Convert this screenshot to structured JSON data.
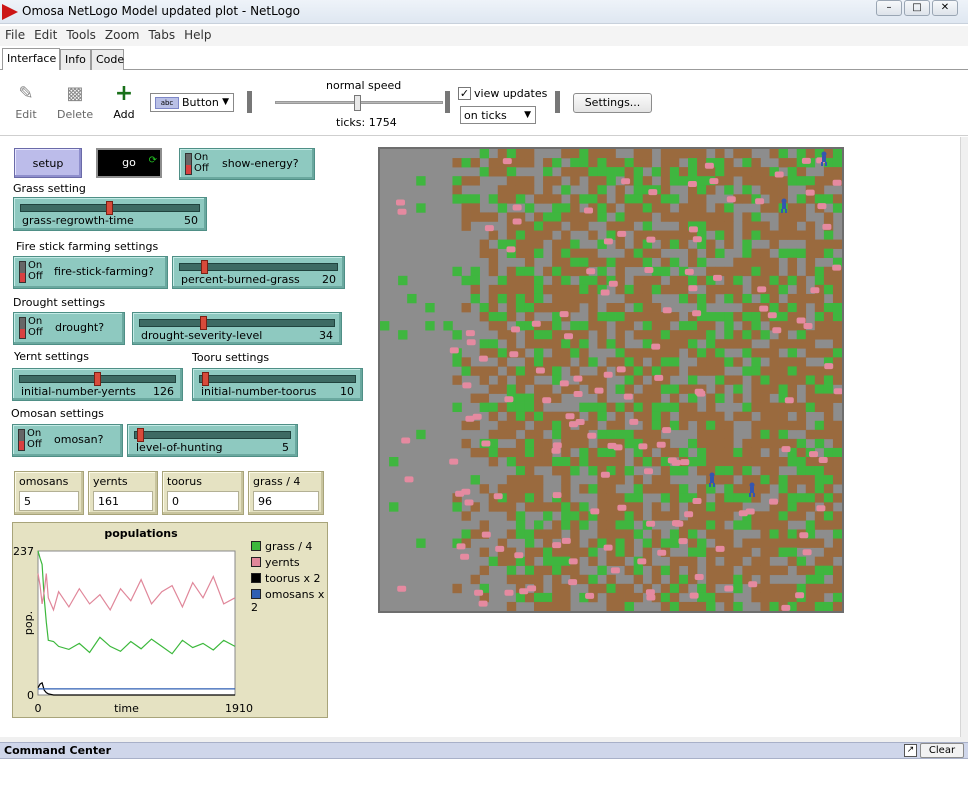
{
  "window": {
    "title": "Omosa NetLogo Model updated plot - NetLogo"
  },
  "menu": [
    "File",
    "Edit",
    "Tools",
    "Zoom",
    "Tabs",
    "Help"
  ],
  "tabs": [
    {
      "label": "Interface",
      "active": true
    },
    {
      "label": "Info",
      "active": false
    },
    {
      "label": "Code",
      "active": false
    }
  ],
  "toolbar": {
    "edit": "Edit",
    "delete": "Delete",
    "add": "Add",
    "widget_type": "Button",
    "widget_icon_text": "abc",
    "speed_label": "normal speed",
    "speed_fraction": 0.5,
    "ticks": "ticks: 1754",
    "view_updates_label": "view updates",
    "view_updates_checked": true,
    "view_updates_mode": "on ticks",
    "settings": "Settings..."
  },
  "widgets": {
    "setup": "setup",
    "go": "go",
    "show_energy": {
      "on": "On",
      "off": "Off",
      "label": "show-energy?"
    },
    "notes": {
      "grass": "Grass setting",
      "fire": "Fire stick farming settings",
      "drought": "Drought settings",
      "yernt": "Yernt settings",
      "tooru": "Tooru settings",
      "omosan": "Omosan settings"
    },
    "sliders": {
      "grass_regrowth": {
        "label": "grass-regrowth-time",
        "value": "50",
        "fraction": 0.5
      },
      "percent_burned": {
        "label": "percent-burned-grass",
        "value": "20",
        "fraction": 0.2
      },
      "drought_severity": {
        "label": "drought-severity-level",
        "value": "34",
        "fraction": 0.34
      },
      "yernts": {
        "label": "initial-number-yernts",
        "value": "126",
        "fraction": 0.5
      },
      "toorus": {
        "label": "initial-number-toorus",
        "value": "10",
        "fraction": 0.02
      },
      "hunting": {
        "label": "level-of-hunting",
        "value": "5",
        "fraction": 0.05
      }
    },
    "switches": {
      "fire": {
        "on": "On",
        "off": "Off",
        "label": "fire-stick-farming?"
      },
      "drought": {
        "on": "On",
        "off": "Off",
        "label": "drought?"
      },
      "omosan": {
        "on": "On",
        "off": "Off",
        "label": "omosan?"
      }
    },
    "monitors": [
      {
        "label": "omosans",
        "value": "5"
      },
      {
        "label": "yernts",
        "value": "161"
      },
      {
        "label": "toorus",
        "value": "0"
      },
      {
        "label": "grass / 4",
        "value": "96"
      }
    ]
  },
  "chart_data": {
    "type": "line",
    "title": "populations",
    "xlabel": "time",
    "ylabel": "pop.",
    "xlim": [
      0,
      1910
    ],
    "ylim": [
      0,
      237
    ],
    "x_tick_labels": [
      "0",
      "1910"
    ],
    "y_tick_labels": [
      "0",
      "237"
    ],
    "legend_position": "right",
    "series": [
      {
        "name": "grass / 4",
        "color": "#3cb83c",
        "x": [
          0,
          20,
          40,
          60,
          80,
          100,
          150,
          200,
          300,
          400,
          500,
          600,
          700,
          800,
          900,
          1000,
          1100,
          1200,
          1300,
          1400,
          1500,
          1600,
          1700,
          1800,
          1910
        ],
        "y": [
          237,
          225,
          215,
          160,
          120,
          90,
          88,
          80,
          75,
          85,
          70,
          95,
          80,
          72,
          88,
          76,
          92,
          80,
          68,
          90,
          78,
          85,
          74,
          90,
          80
        ]
      },
      {
        "name": "yernts",
        "color": "#e0879a",
        "x": [
          0,
          20,
          40,
          60,
          80,
          100,
          150,
          200,
          300,
          400,
          500,
          600,
          700,
          800,
          900,
          1000,
          1100,
          1200,
          1300,
          1400,
          1500,
          1600,
          1700,
          1800,
          1910
        ],
        "y": [
          200,
          180,
          150,
          170,
          200,
          160,
          140,
          170,
          145,
          175,
          150,
          165,
          140,
          175,
          155,
          190,
          150,
          170,
          180,
          145,
          185,
          160,
          195,
          150,
          160
        ]
      },
      {
        "name": "toorus x 2",
        "color": "#000000",
        "x": [
          0,
          20,
          40,
          60,
          80,
          100,
          150,
          300,
          1910
        ],
        "y": [
          12,
          18,
          20,
          8,
          4,
          2,
          0,
          0,
          0
        ]
      },
      {
        "name": "omosans x 2",
        "color": "#2f5fb3",
        "x": [
          0,
          20,
          40,
          60,
          80,
          100,
          300,
          1910
        ],
        "y": [
          10,
          10,
          10,
          10,
          10,
          10,
          10,
          10
        ]
      }
    ]
  },
  "world": {
    "colors": {
      "grass": "#3fb63f",
      "dirt": "#9a6a3e",
      "gray": "#8d8d8d",
      "yernt": "#e58aa0",
      "omosan": "#3556b0"
    },
    "omosans_shown": 4,
    "yernts_shown": 161
  },
  "command_center": {
    "title": "Command Center",
    "clear": "Clear"
  }
}
